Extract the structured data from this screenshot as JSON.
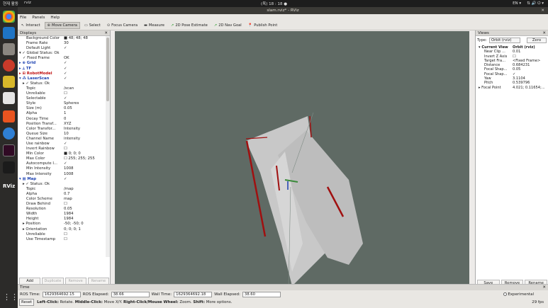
{
  "os": {
    "activities": "현재 활동",
    "app": "rviz",
    "clock": "(목) 18 : 18 ●",
    "lang": "EN ▾",
    "tray": "⇅ 🔊 ⏻ ▾"
  },
  "window": {
    "title": "slam.rviz* - RViz",
    "close": "✕"
  },
  "menu": [
    "File",
    "Panels",
    "Help"
  ],
  "toolbar": [
    {
      "label": "Interact",
      "active": false
    },
    {
      "label": "Move Camera",
      "active": true
    },
    {
      "label": "Select",
      "active": false
    },
    {
      "label": "Focus Camera",
      "active": false
    },
    {
      "label": "Measure",
      "active": false
    },
    {
      "label": "2D Pose Estimate",
      "active": false
    },
    {
      "label": "2D Nav Goal",
      "active": false
    },
    {
      "label": "Publish Point",
      "active": false
    }
  ],
  "displays": {
    "title": "Displays",
    "rows": [
      {
        "i": 2,
        "k": "Background Color",
        "v": "■ 48; 48; 48"
      },
      {
        "i": 2,
        "k": "Frame Rate",
        "v": "30"
      },
      {
        "i": 2,
        "k": "Default Light",
        "v": "✓"
      },
      {
        "i": 0,
        "k": "▾ ✓ Global Status: Ok",
        "v": ""
      },
      {
        "i": 1,
        "k": "✓ Fixed Frame",
        "v": "OK"
      },
      {
        "i": 0,
        "k": "▸ ⊕ Grid",
        "v": "✓",
        "c": "#1a3fb0"
      },
      {
        "i": 0,
        "k": "▸ ⟂ TF",
        "v": "✓",
        "c": "#1a3fb0"
      },
      {
        "i": 0,
        "k": "▸ ⊞ RobotModel",
        "v": "✓",
        "c": "#c01010"
      },
      {
        "i": 0,
        "k": "▾ ⁂ LaserScan",
        "v": "✓",
        "c": "#1a3fb0"
      },
      {
        "i": 1,
        "k": "▸ ✓ Status: Ok",
        "v": ""
      },
      {
        "i": 2,
        "k": "Topic",
        "v": "/scan"
      },
      {
        "i": 2,
        "k": "Unreliable",
        "v": "☐"
      },
      {
        "i": 2,
        "k": "Selectable",
        "v": "✓"
      },
      {
        "i": 2,
        "k": "Style",
        "v": "Spheres"
      },
      {
        "i": 2,
        "k": "Size (m)",
        "v": "0.05"
      },
      {
        "i": 2,
        "k": "Alpha",
        "v": "1"
      },
      {
        "i": 2,
        "k": "Decay Time",
        "v": "0"
      },
      {
        "i": 2,
        "k": "Position Transf...",
        "v": "XYZ"
      },
      {
        "i": 2,
        "k": "Color Transfor...",
        "v": "Intensity"
      },
      {
        "i": 2,
        "k": "Queue Size",
        "v": "10"
      },
      {
        "i": 2,
        "k": "Channel Name",
        "v": "intensity"
      },
      {
        "i": 2,
        "k": "Use rainbow",
        "v": "✓"
      },
      {
        "i": 2,
        "k": "Invert Rainbow",
        "v": "☐"
      },
      {
        "i": 2,
        "k": "Min Color",
        "v": "■ 0; 0; 0"
      },
      {
        "i": 2,
        "k": "Max Color",
        "v": "☐ 255; 255; 255"
      },
      {
        "i": 2,
        "k": "Autocompute I...",
        "v": "✓"
      },
      {
        "i": 2,
        "k": "Min Intensity",
        "v": "1008"
      },
      {
        "i": 2,
        "k": "Max Intensity",
        "v": "1008"
      },
      {
        "i": 0,
        "k": "▾ ▦ Map",
        "v": "✓",
        "c": "#1a3fb0"
      },
      {
        "i": 1,
        "k": "▸ ✓ Status: Ok",
        "v": ""
      },
      {
        "i": 2,
        "k": "Topic",
        "v": "/map"
      },
      {
        "i": 2,
        "k": "Alpha",
        "v": "0.7"
      },
      {
        "i": 2,
        "k": "Color Scheme",
        "v": "map"
      },
      {
        "i": 2,
        "k": "Draw Behind",
        "v": "☐"
      },
      {
        "i": 2,
        "k": "Resolution",
        "v": "0.05"
      },
      {
        "i": 2,
        "k": "Width",
        "v": "1984"
      },
      {
        "i": 2,
        "k": "Height",
        "v": "1984"
      },
      {
        "i": 1,
        "k": "▸ Position",
        "v": "-50; -50; 0"
      },
      {
        "i": 1,
        "k": "▸ Orientation",
        "v": "0; 0; 0; 1"
      },
      {
        "i": 2,
        "k": "Unreliable",
        "v": "☐"
      },
      {
        "i": 2,
        "k": "Use Timestamp",
        "v": "☐"
      }
    ],
    "buttons": [
      {
        "label": "Add",
        "dis": false
      },
      {
        "label": "Duplicate",
        "dis": true
      },
      {
        "label": "Remove",
        "dis": true
      },
      {
        "label": "Rename",
        "dis": true
      }
    ]
  },
  "views": {
    "title": "Views",
    "type_label": "Type:",
    "type_value": "Orbit (rviz)",
    "zero": "Zero",
    "rows": [
      {
        "i": 0,
        "k": "▾ Current View",
        "v": "Orbit (rviz)",
        "b": true
      },
      {
        "i": 1,
        "k": "Near Clip ...",
        "v": "0.01"
      },
      {
        "i": 1,
        "k": "Invert Z Axis",
        "v": "☐"
      },
      {
        "i": 1,
        "k": "Target Fra...",
        "v": "<Fixed Frame>"
      },
      {
        "i": 1,
        "k": "Distance",
        "v": "0.684231"
      },
      {
        "i": 1,
        "k": "Focal Shap...",
        "v": "0.05"
      },
      {
        "i": 1,
        "k": "Focal Shap...",
        "v": "✓"
      },
      {
        "i": 1,
        "k": "Yaw",
        "v": "3.1104"
      },
      {
        "i": 1,
        "k": "Pitch",
        "v": "0.539796"
      },
      {
        "i": 0,
        "k": "▸ Focal Point",
        "v": "4.021; 0.11654;..."
      }
    ],
    "buttons": [
      "Save",
      "Remove",
      "Rename"
    ]
  },
  "time": {
    "title": "Time",
    "ros_time_label": "ROS Time:",
    "ros_time": "1629364692.15",
    "ros_elapsed_label": "ROS Elapsed:",
    "ros_elapsed": "38.66",
    "wall_time_label": "Wall Time:",
    "wall_time": "1629364692.18",
    "wall_elapsed_label": "Wall Elapsed:",
    "wall_elapsed": "38.60",
    "experimental": "Experimental"
  },
  "status": {
    "reset": "Reset",
    "hint_b1": "Left-Click:",
    "hint1": " Rotate. ",
    "hint_b2": "Middle-Click:",
    "hint2": " Move X/Y. ",
    "hint_b3": "Right-Click/Mouse Wheel:",
    "hint3": " Zoom. ",
    "hint_b4": "Shift:",
    "hint4": " More options.",
    "fps": "29 fps"
  },
  "colors": {
    "viewport": "#5f6a64",
    "scan": "#d42020",
    "map_free": "#c8c8c8",
    "map_occupied": "#202020"
  }
}
